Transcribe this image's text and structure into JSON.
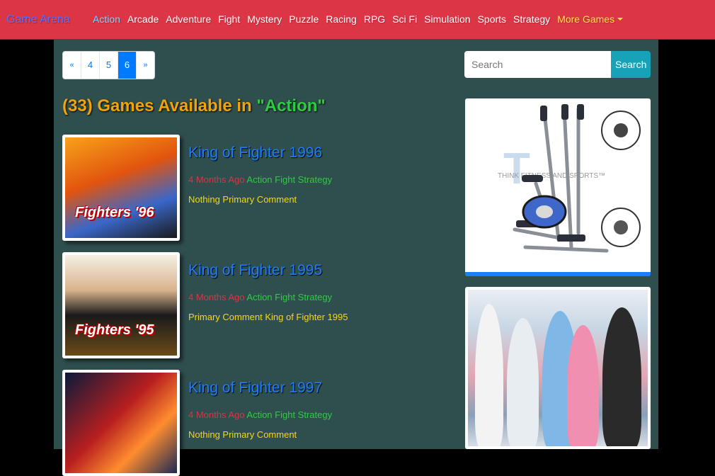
{
  "brand": "Game Arena",
  "nav": [
    {
      "label": "Action",
      "active": true
    },
    {
      "label": "Arcade"
    },
    {
      "label": "Adventure"
    },
    {
      "label": "Fight"
    },
    {
      "label": "Mystery"
    },
    {
      "label": "Puzzle"
    },
    {
      "label": "Racing"
    },
    {
      "label": "RPG"
    },
    {
      "label": "Sci Fi"
    },
    {
      "label": "Simulation"
    },
    {
      "label": "Sports"
    },
    {
      "label": "Strategy"
    }
  ],
  "more_games_label": "More Games",
  "pagination": {
    "prev": "«",
    "pages": [
      "4",
      "5",
      "6"
    ],
    "current": "6",
    "next": "»"
  },
  "search": {
    "placeholder": "Search",
    "button_label": "Search"
  },
  "heading": {
    "count": "(33)",
    "text": "Games Available in",
    "category": "\"Action\""
  },
  "games": [
    {
      "title": "King of Fighter 1996",
      "time_ago": "4 Months Ago",
      "tags": "Action Fight Strategy",
      "comment": "Nothing Primary Comment",
      "thumb_text": "Fighters '96"
    },
    {
      "title": "King of Fighter 1995",
      "time_ago": "4 Months Ago",
      "tags": "Action Fight Strategy",
      "comment": "Primary Comment King of Fighter 1995",
      "thumb_text": "Fighters '95"
    },
    {
      "title": "King of Fighter 1997",
      "time_ago": "4 Months Ago",
      "tags": "Action Fight Strategy",
      "comment": "Nothing Primary Comment",
      "thumb_text": ""
    }
  ],
  "ads": {
    "ad1_watermark": "THINK FITNESS AND SPORTS™",
    "ad1_logo_letter": "T"
  },
  "colors": {
    "topbar": "#dc3545",
    "page_bg": "#2f4f4f",
    "heading": "#f0a30a",
    "category": "#2ecc40",
    "title": "#1e7cff",
    "time_ago": "#e03044",
    "tags": "#2ecc40",
    "comment": "#f5d90a",
    "search_button": "#17a2b8",
    "pager_active": "#007bff"
  }
}
